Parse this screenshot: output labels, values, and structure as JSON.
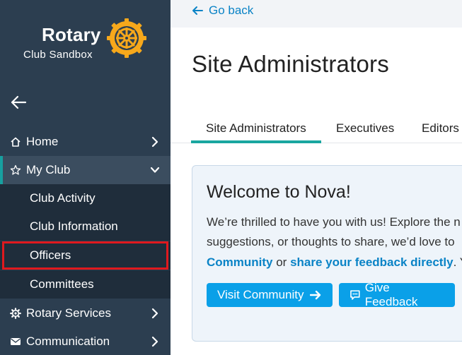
{
  "sidebar": {
    "logo": {
      "word": "Rotary",
      "subtitle": "Club Sandbox"
    },
    "nav": {
      "home": "Home",
      "my_club": "My Club",
      "sub": [
        "Club Activity",
        "Club Information",
        "Officers",
        "Committees"
      ],
      "rotary_services": "Rotary Services",
      "communication": "Communication"
    }
  },
  "header": {
    "go_back": "Go back",
    "title": "Site Administrators"
  },
  "tabs": [
    "Site Administrators",
    "Executives",
    "Editors"
  ],
  "welcome": {
    "title": "Welcome to Nova!",
    "line1": "We’re thrilled to have you with us! Explore the n",
    "line2": "suggestions, or thoughts to share, we’d love to",
    "line3_link1": "Community",
    "line3_mid": " or ",
    "line3_link2": "share your feedback directly",
    "line3_tail": ". Yo",
    "visit_button": "Visit Community",
    "feedback_button": "Give Feedback"
  },
  "colors": {
    "sidebar_bg": "#2c3e50",
    "accent_teal": "#1aa6a0",
    "primary_blue": "#0aa0e8",
    "link_blue": "#0a83c6",
    "highlight_red": "#e0191e",
    "rotary_gold": "#f7a81b"
  }
}
